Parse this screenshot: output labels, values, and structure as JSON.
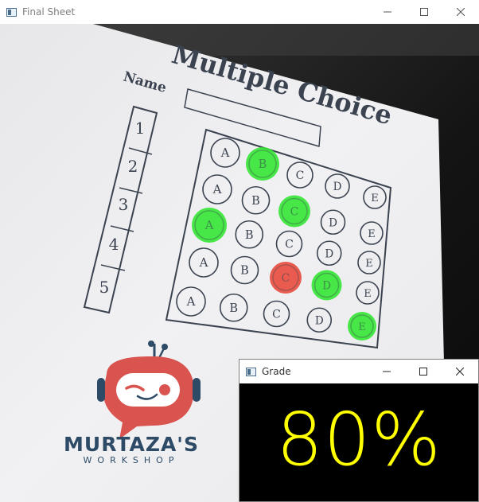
{
  "final_window": {
    "title": "Final Sheet",
    "sheet": {
      "heading": "Multiple Choice",
      "name_label": "Name",
      "question_numbers": [
        "1",
        "2",
        "3",
        "4",
        "5"
      ],
      "options": [
        "A",
        "B",
        "C",
        "D",
        "E"
      ],
      "logo_line1": "MURTAZA'S",
      "logo_line2": "WORKSHOP"
    }
  },
  "grade_window": {
    "title": "Grade",
    "value": "80%"
  },
  "colors": {
    "correct_mark": "#33e633",
    "wrong_mark": "#e84a3c",
    "grade_text": "#ffff00",
    "robot_red": "#d9534f",
    "logo_navy": "#2d4a66"
  },
  "icons": {
    "minimize": "minimize-icon",
    "maximize": "maximize-icon",
    "close": "close-icon"
  }
}
